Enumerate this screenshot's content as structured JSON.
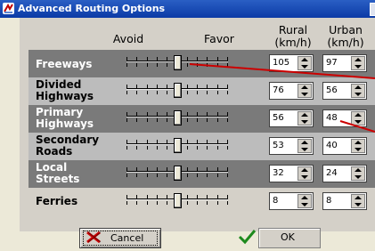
{
  "window": {
    "title": "Advanced Routing Options",
    "icon": "routing-app-icon"
  },
  "columns": {
    "avoid": "Avoid",
    "favor": "Favor",
    "rural": "Rural\n(km/h)",
    "urban": "Urban\n(km/h)"
  },
  "roads": [
    {
      "label": "Freeways",
      "rural": "105",
      "urban": "97",
      "shade": "dark"
    },
    {
      "label": "Divided\nHighways",
      "rural": "76",
      "urban": "56",
      "shade": "light"
    },
    {
      "label": "Primary\nHighways",
      "rural": "56",
      "urban": "48",
      "shade": "dark"
    },
    {
      "label": "Secondary\nRoads",
      "rural": "53",
      "urban": "40",
      "shade": "light"
    },
    {
      "label": "Local\nStreets",
      "rural": "32",
      "urban": "24",
      "shade": "dark"
    },
    {
      "label": "Ferries",
      "rural": "8",
      "urban": "8",
      "shade": "plain"
    }
  ],
  "buttons": {
    "cancel": "Cancel",
    "ok": "OK"
  },
  "colors": {
    "title_bar": "#0b3aa6",
    "row_dark": "#7a7a7a",
    "row_light": "#bcbcbc",
    "annotation": "#cc0000"
  }
}
